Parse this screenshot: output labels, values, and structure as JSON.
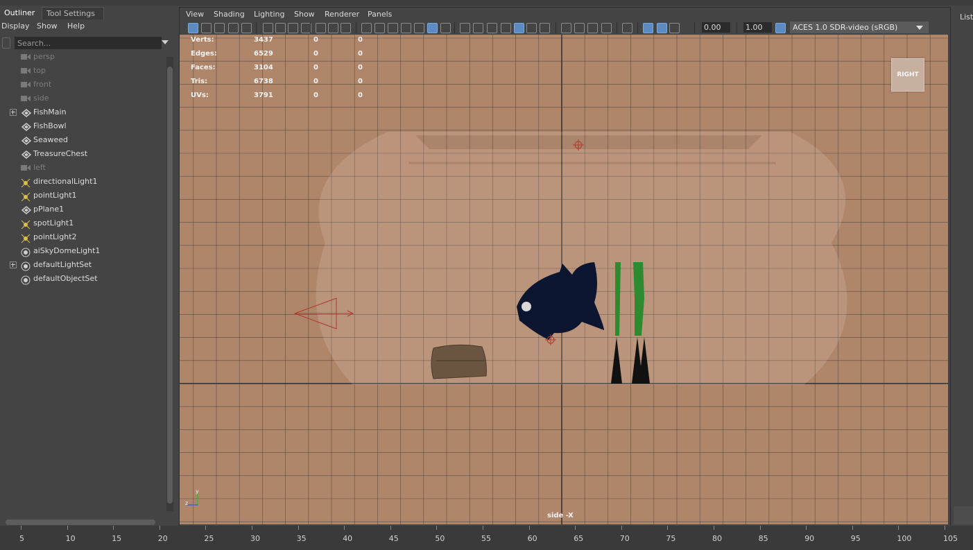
{
  "outliner": {
    "tabs": [
      {
        "label": "Outliner"
      },
      {
        "label": "Tool Settings"
      }
    ],
    "menu": [
      {
        "label": "Display"
      },
      {
        "label": "Show"
      },
      {
        "label": "Help"
      }
    ],
    "search_placeholder": "Search...",
    "items": [
      {
        "label": "persp",
        "icon": "camera-icon",
        "dim": true,
        "expandable": false
      },
      {
        "label": "top",
        "icon": "camera-icon",
        "dim": true,
        "expandable": false
      },
      {
        "label": "front",
        "icon": "camera-icon",
        "dim": true,
        "expandable": false
      },
      {
        "label": "side",
        "icon": "camera-icon",
        "dim": true,
        "expandable": false
      },
      {
        "label": "FishMain",
        "icon": "transform-icon",
        "dim": false,
        "expandable": true
      },
      {
        "label": "FishBowl",
        "icon": "transform-icon",
        "dim": false,
        "expandable": false
      },
      {
        "label": "Seaweed",
        "icon": "transform-icon",
        "dim": false,
        "expandable": false
      },
      {
        "label": "TreasureChest",
        "icon": "transform-icon",
        "dim": false,
        "expandable": false
      },
      {
        "label": "left",
        "icon": "camera-icon",
        "dim": true,
        "expandable": false
      },
      {
        "label": "directionalLight1",
        "icon": "directional-light-icon",
        "dim": false,
        "expandable": false
      },
      {
        "label": "pointLight1",
        "icon": "point-light-icon",
        "dim": false,
        "expandable": false
      },
      {
        "label": "pPlane1",
        "icon": "transform-icon",
        "dim": false,
        "expandable": false
      },
      {
        "label": "spotLight1",
        "icon": "spot-light-icon",
        "dim": false,
        "expandable": false
      },
      {
        "label": "pointLight2",
        "icon": "point-light-icon",
        "dim": false,
        "expandable": false
      },
      {
        "label": "aiSkyDomeLight1",
        "icon": "skydome-light-icon",
        "dim": false,
        "expandable": false
      },
      {
        "label": "defaultLightSet",
        "icon": "set-icon",
        "dim": false,
        "expandable": true
      },
      {
        "label": "defaultObjectSet",
        "icon": "set-icon",
        "dim": false,
        "expandable": false
      }
    ]
  },
  "viewport": {
    "menu": [
      {
        "label": "View"
      },
      {
        "label": "Shading"
      },
      {
        "label": "Lighting"
      },
      {
        "label": "Show"
      },
      {
        "label": "Renderer"
      },
      {
        "label": "Panels"
      }
    ],
    "exposure": "0.00",
    "gamma": "1.00",
    "color_space": "ACES 1.0 SDR-video (sRGB)",
    "hud": [
      {
        "name": "Verts:",
        "values": [
          "3437",
          "0",
          "0"
        ]
      },
      {
        "name": "Edges:",
        "values": [
          "6529",
          "0",
          "0"
        ]
      },
      {
        "name": "Faces:",
        "values": [
          "3104",
          "0",
          "0"
        ]
      },
      {
        "name": "Tris:",
        "values": [
          "6738",
          "0",
          "0"
        ]
      },
      {
        "name": "UVs:",
        "values": [
          "3791",
          "0",
          "0"
        ]
      }
    ],
    "camera_label": "side -X",
    "view_cube_label": "RIGHT",
    "axis_labels": {
      "z": "z",
      "y": "y"
    },
    "colors": {
      "background": "#b0866b",
      "grid": "#3a3a3a",
      "fish": "#0d1630",
      "seaweed": "#2e8a2e",
      "chest": "#6b5540",
      "light": "#b03a2a"
    }
  },
  "right_panel": {
    "label": "List"
  },
  "timeline": {
    "ticks": [
      "5",
      "10",
      "15",
      "20",
      "25",
      "30",
      "35",
      "40",
      "45",
      "50",
      "55",
      "60",
      "65",
      "70",
      "75",
      "80",
      "85",
      "90",
      "95",
      "100",
      "105"
    ]
  }
}
